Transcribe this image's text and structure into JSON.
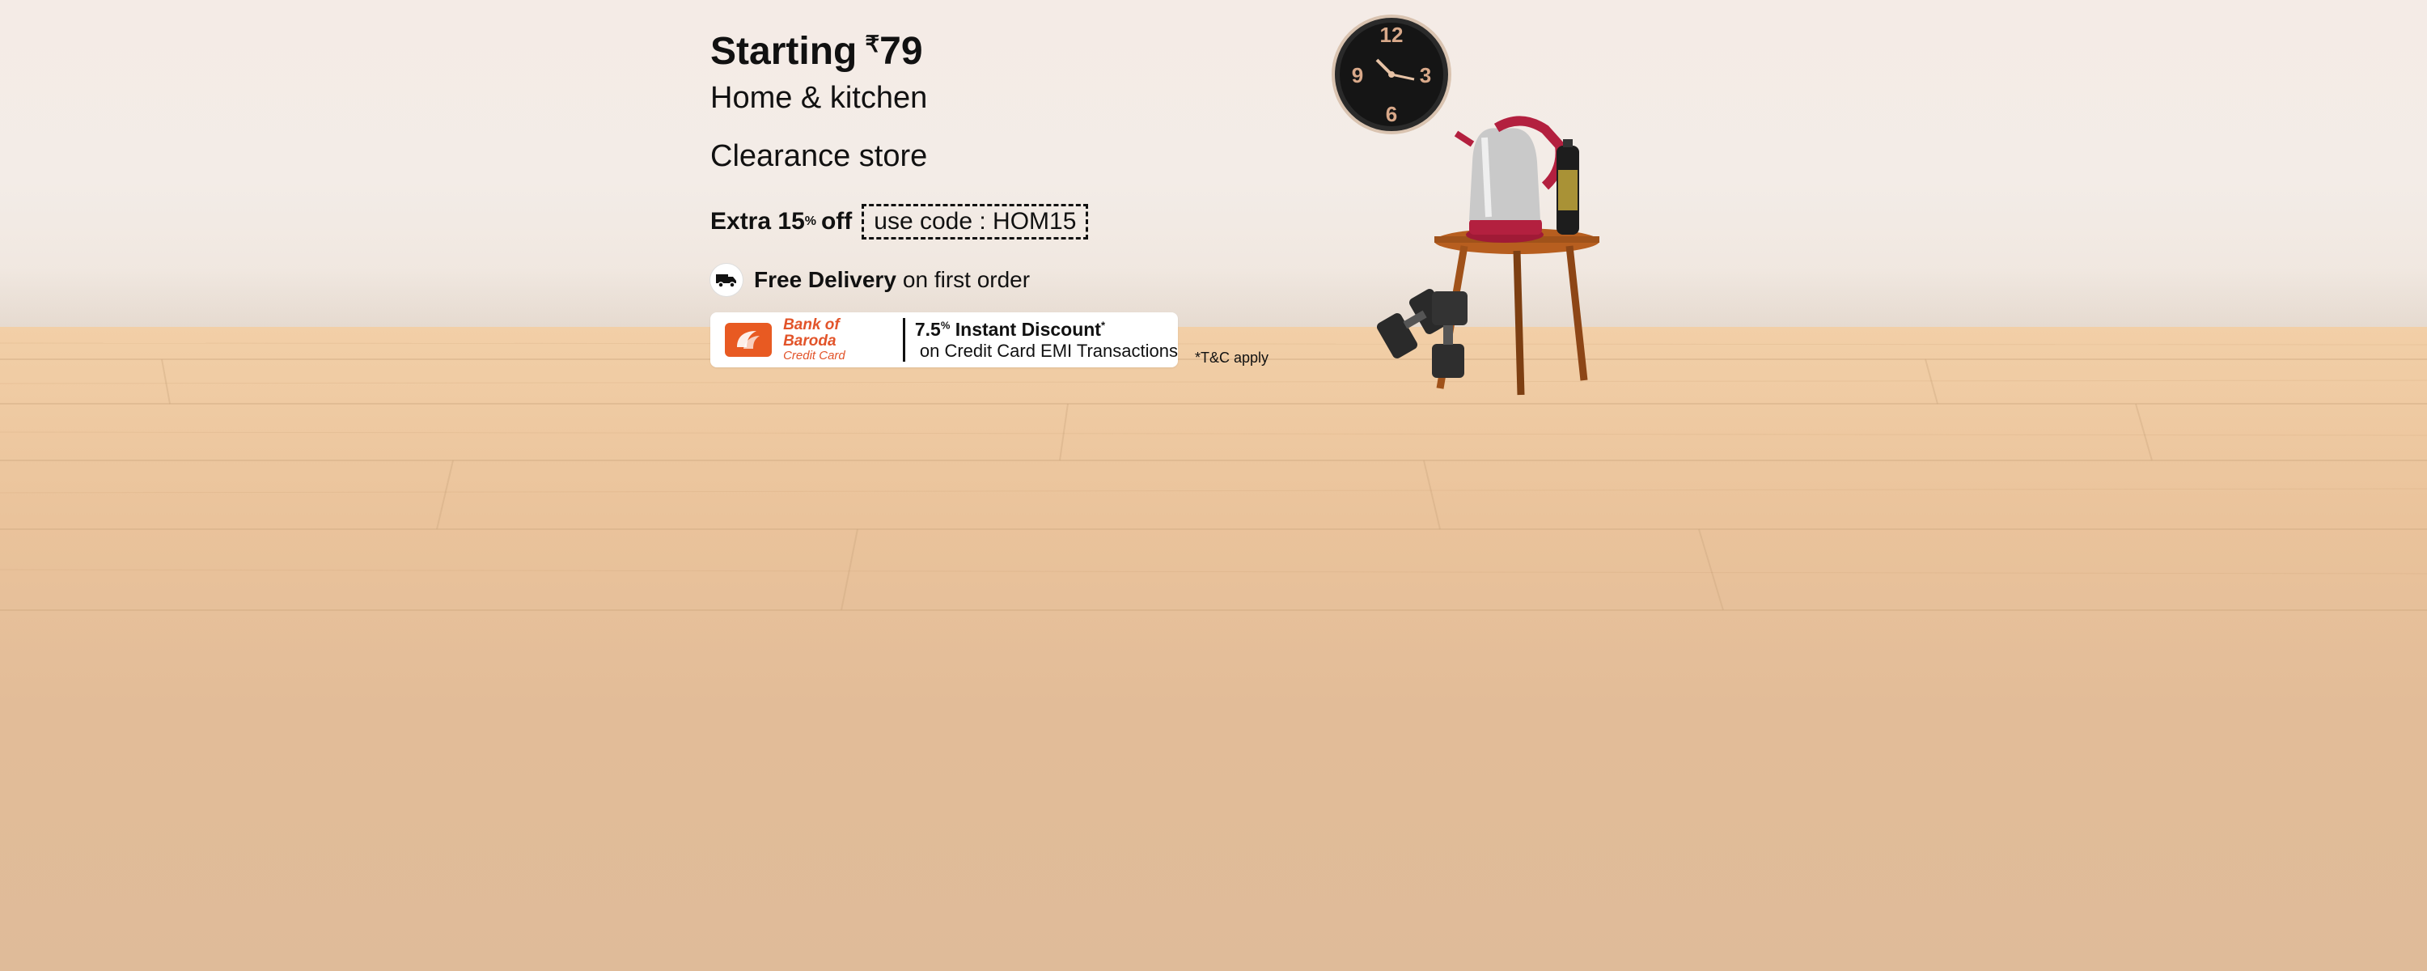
{
  "banner": {
    "headline_prefix": "Starting",
    "currency_symbol": "₹",
    "headline_price": "79",
    "category": "Home & kitchen",
    "subtitle": "Clearance store",
    "offer_prefix": "Extra 15",
    "offer_percent": "%",
    "offer_suffix": "off",
    "promo_code_label": "use code : HOM15",
    "delivery_bold": "Free Delivery",
    "delivery_rest": "on first order",
    "bank_name": "Bank of Baroda",
    "bank_card_type": "Credit Card",
    "discount_value": "7.5",
    "discount_percent": "%",
    "discount_title": "Instant Discount",
    "discount_asterisk": "*",
    "discount_detail": "on Credit Card EMI Transactions",
    "terms": "*T&C apply"
  },
  "colors": {
    "wall": "#f3ece7",
    "floor": "#e8c29c",
    "bank_brand": "#e85a22",
    "text": "#111111"
  },
  "icons": [
    "truck-icon",
    "bank-of-baroda-logo",
    "wall-clock",
    "electric-kettle",
    "side-table",
    "dumbbell",
    "spray-can"
  ]
}
